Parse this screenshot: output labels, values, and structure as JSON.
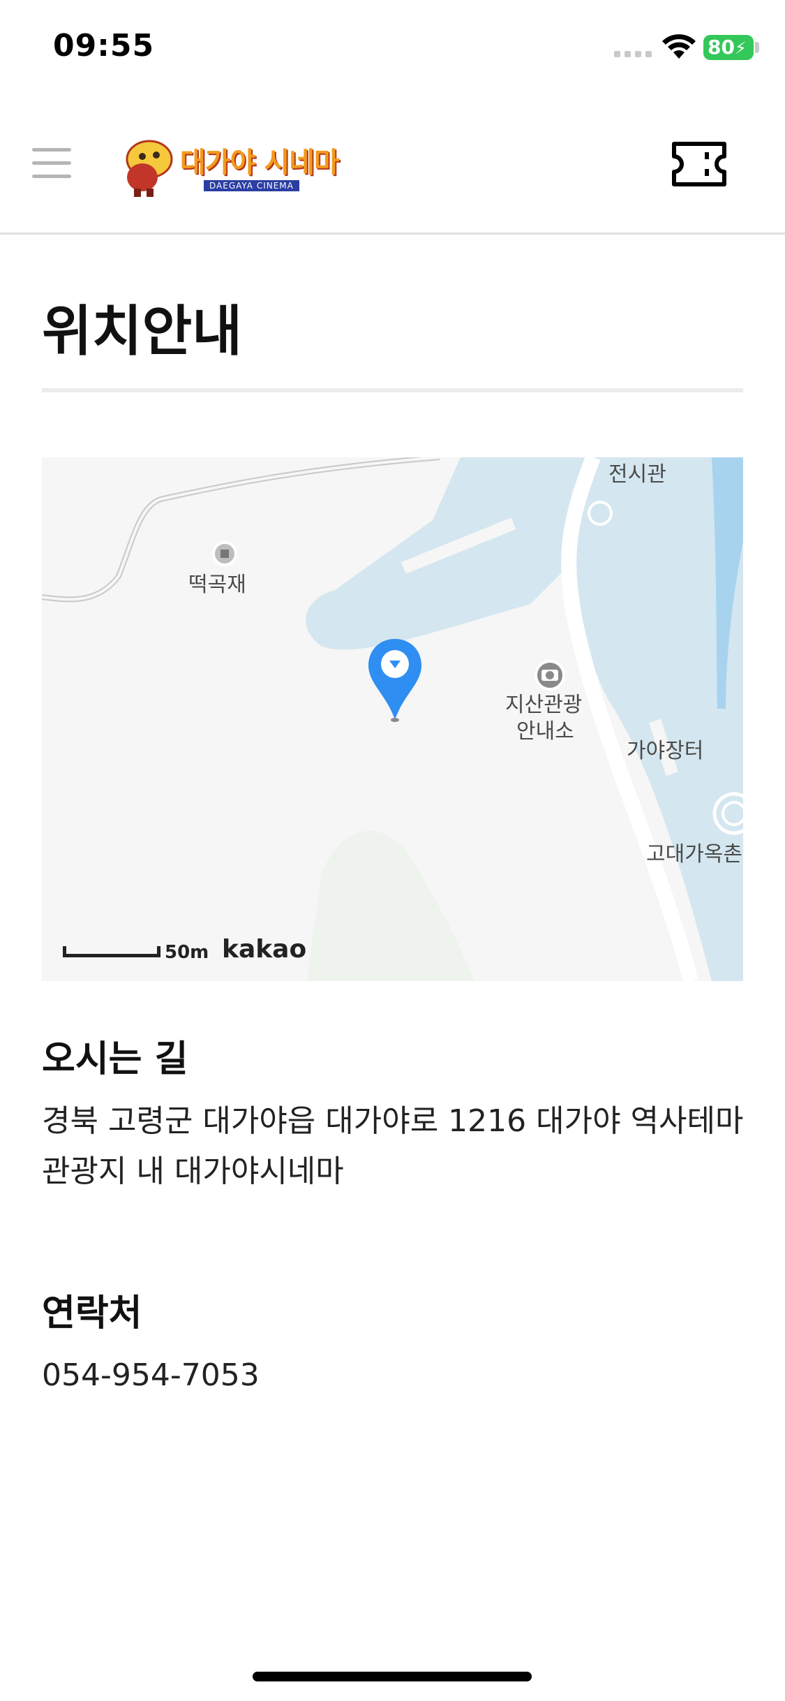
{
  "status_bar": {
    "time": "09:55",
    "battery": "80",
    "icons": [
      "signal-icon",
      "wifi-icon",
      "battery-charging-icon"
    ]
  },
  "header": {
    "menu_icon": "hamburger-menu-icon",
    "logo_text": "대가야 시네마",
    "logo_subtext": "DAEGAYA CINEMA",
    "ticket_icon": "ticket-icon"
  },
  "page": {
    "title": "위치안내"
  },
  "map": {
    "labels": {
      "tteokgokjae": "떡곡재",
      "jeonsigwan": "전시관",
      "jisan_line1": "지산관광",
      "jisan_line2": "안내소",
      "gaya_market": "가야장터",
      "ancient_house": "고대가옥촌"
    },
    "scale": "50m",
    "provider": "kakao",
    "marker_icon": "location-pin-icon"
  },
  "directions": {
    "title": "오시는 길",
    "address": "경북 고령군 대가야읍 대가야로 1216 대가야 역사테마관광지 내 대가야시네마"
  },
  "contact": {
    "title": "연락처",
    "phone": "054-954-7053"
  },
  "colors": {
    "accent_blue": "#2f8ef2",
    "battery_green": "#34c759",
    "water": "#d4e6ef",
    "logo_orange": "#f39a1e"
  }
}
